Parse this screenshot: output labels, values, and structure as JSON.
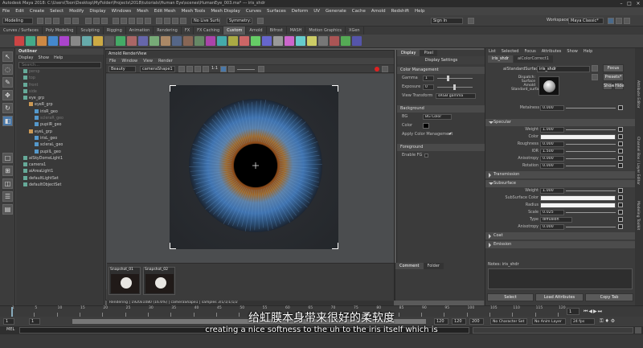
{
  "window": {
    "title": "Autodesk Maya 2018: C:\\Users\\Toon\\Desktop\\MyFolder\\Projects\\2018\\tutorials\\Human Eye\\scenes\\HumanEye_003.ma* --- iris_shdr"
  },
  "menubar": [
    "File",
    "Edit",
    "Create",
    "Select",
    "Modify",
    "Display",
    "Windows",
    "Mesh",
    "Edit Mesh",
    "Mesh Tools",
    "Mesh Display",
    "Curves",
    "Surfaces",
    "Deform",
    "UV",
    "Generate",
    "Cache",
    "Arnold",
    "Redshift",
    "Help"
  ],
  "status_line": {
    "mode": "Modeling",
    "live_surface": "No Live Surface",
    "symmetry": "Symmetry: Off",
    "sign_in": "Sign In",
    "workspace_label": "Workspace :",
    "workspace": "Maya Classic*"
  },
  "shelf_tabs": [
    "Curves / Surfaces",
    "Poly Modeling",
    "Sculpting",
    "Rigging",
    "Animation",
    "Rendering",
    "FX",
    "FX Caching",
    "Custom",
    "Arnold",
    "Bifrost",
    "MASH",
    "Motion Graphics",
    "XGen"
  ],
  "shelf_active": "Custom",
  "outliner": {
    "title": "Outliner",
    "menu": [
      "Display",
      "Show",
      "Help"
    ],
    "search_placeholder": "Search...",
    "items": [
      {
        "name": "persp",
        "indent": 1,
        "dim": true
      },
      {
        "name": "top",
        "indent": 1,
        "dim": true
      },
      {
        "name": "front",
        "indent": 1,
        "dim": true
      },
      {
        "name": "side",
        "indent": 1,
        "dim": true
      },
      {
        "name": "eye_grp",
        "indent": 1,
        "dim": false
      },
      {
        "name": "eyeR_grp",
        "indent": 2,
        "dim": false
      },
      {
        "name": "irisR_geo",
        "indent": 3,
        "dim": false
      },
      {
        "name": "scleraR_geo",
        "indent": 3,
        "dim": true
      },
      {
        "name": "pupilR_geo",
        "indent": 3,
        "dim": false
      },
      {
        "name": "eyeL_grp",
        "indent": 2,
        "dim": false
      },
      {
        "name": "irisL_geo",
        "indent": 3,
        "dim": false
      },
      {
        "name": "scleraL_geo",
        "indent": 3,
        "dim": false
      },
      {
        "name": "pupilL_geo",
        "indent": 3,
        "dim": false
      },
      {
        "name": "aiSkyDomeLight1",
        "indent": 1,
        "dim": false
      },
      {
        "name": "camera1",
        "indent": 1,
        "dim": false
      },
      {
        "name": "aiAreaLight1",
        "indent": 1,
        "dim": false
      },
      {
        "name": "defaultLightSet",
        "indent": 1,
        "dim": false
      },
      {
        "name": "defaultObjectSet",
        "indent": 1,
        "dim": false
      }
    ]
  },
  "render_view": {
    "title": "Arnold RenderView",
    "menu": [
      "File",
      "Window",
      "View",
      "Render"
    ],
    "display_mode": "Beauty",
    "camera": "cameraShape1",
    "zoom": "1:1",
    "status": "Rendering | 1920x1080 (16.6%) | cameraShape1 | samples 3/1/1/1/1/2",
    "settings_tabs": [
      "Display",
      "Pixel"
    ],
    "settings_title": "Display Settings",
    "color_mgmt": {
      "section": "Color Management",
      "gamma_label": "Gamma",
      "gamma": "1",
      "exposure_label": "Exposure",
      "exposure": "0",
      "view_transform_label": "View Transform",
      "view_transform": "sRGB gamma"
    },
    "background": {
      "section": "Background",
      "bg_label": "BG",
      "bg": "BG Color",
      "color_label": "Color",
      "apply_label": "Apply Color Management"
    },
    "foreground": {
      "section": "Foreground",
      "enable_label": "Enable FG"
    },
    "comment_tabs": [
      "Comment",
      "Folder"
    ],
    "snapshots": [
      "Snapshot_01",
      "Snapshot_02"
    ]
  },
  "attribute_editor": {
    "menu": [
      "List",
      "Selected",
      "Focus",
      "Attributes",
      "Show",
      "Help"
    ],
    "tabs": [
      "iris_shdr",
      "aiColorCorrect1"
    ],
    "shader_label": "aiStandardSurface:",
    "shader_name": "iris_shdr",
    "focus": "Focus",
    "presets": "Presets*",
    "show": "Show",
    "hide": "Hide",
    "swatch_caption": [
      "Dispatch:",
      "Surface",
      "Arnold",
      "Standard_surface"
    ],
    "metalness_label": "Metalness",
    "metalness": "0.000",
    "specular": {
      "section": "Specular",
      "rows": [
        {
          "label": "Weight",
          "value": "1.000",
          "type": "slider"
        },
        {
          "label": "Color",
          "value": "",
          "type": "color"
        },
        {
          "label": "Roughness",
          "value": "0.000",
          "type": "slider"
        },
        {
          "label": "IOR",
          "value": "1.500",
          "type": "slider"
        },
        {
          "label": "Anisotropy",
          "value": "0.000",
          "type": "slider"
        },
        {
          "label": "Rotation",
          "value": "0.000",
          "type": "slider"
        }
      ]
    },
    "transmission": "Transmission",
    "subsurface": {
      "section": "Subsurface",
      "rows": [
        {
          "label": "Weight",
          "value": "1.000",
          "type": "slider"
        },
        {
          "label": "SubSurface Color",
          "value": "",
          "type": "color"
        },
        {
          "label": "Radius",
          "value": "",
          "type": "color"
        },
        {
          "label": "Scale",
          "value": "0.025",
          "type": "slider"
        },
        {
          "label": "Type",
          "value": "diffusion",
          "type": "dropdown"
        },
        {
          "label": "Anisotropy",
          "value": "0.000",
          "type": "slider"
        }
      ]
    },
    "coat": "Coat",
    "emission": "Emission",
    "notes_label": "Notes: iris_shdr",
    "buttons": [
      "Select",
      "Load Attributes",
      "Copy Tab"
    ]
  },
  "side_tabs": [
    "Attribute Editor",
    "Channel Box / Layer Editor",
    "Modeling Toolkit"
  ],
  "timeline": {
    "ticks": [
      "1",
      "5",
      "10",
      "15",
      "20",
      "25",
      "30",
      "35",
      "40",
      "45",
      "50",
      "55",
      "60",
      "65",
      "70",
      "75",
      "80",
      "85",
      "90",
      "95",
      "100",
      "105",
      "110",
      "115",
      "120"
    ],
    "current": "1"
  },
  "range": {
    "start": "1",
    "start2": "1",
    "end": "120",
    "end2": "120",
    "end3": "200",
    "charset": "No Character Set",
    "anim_layer": "No Anim Layer",
    "fps": "24 fps"
  },
  "cmdline": {
    "label": "MEL"
  },
  "subtitles": {
    "cn": "给虹膜本身带来很好的柔软度",
    "en": "creating a nice softness to the uh to the iris itself which is"
  }
}
